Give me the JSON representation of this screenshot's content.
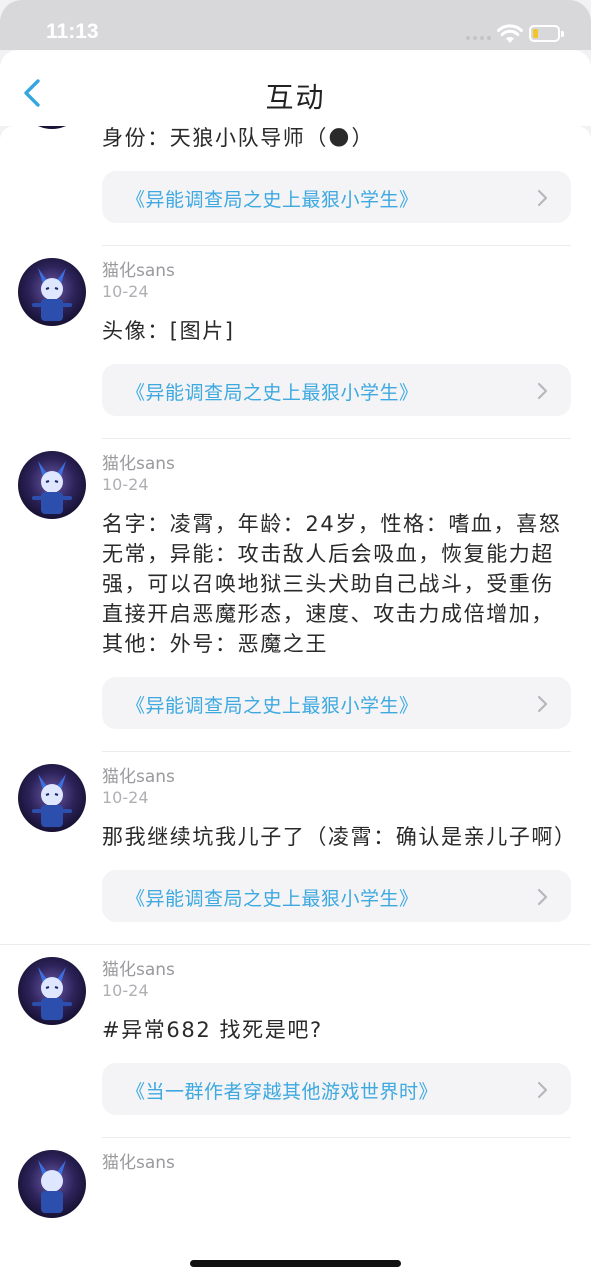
{
  "status_bar": {
    "time": "11:13"
  },
  "header": {
    "title": "互动"
  },
  "posts": [
    {
      "author": "",
      "date": "",
      "text": "身份：天狼小队导师（🌑）",
      "source": "《异能调查局之史上最狠小学生》"
    },
    {
      "author": "猫化sans",
      "date": "10-24",
      "text": "头像：[图片]",
      "source": "《异能调查局之史上最狠小学生》"
    },
    {
      "author": "猫化sans",
      "date": "10-24",
      "text": "名字：凌霄，年龄：24岁，性格：嗜血，喜怒无常，异能：攻击敌人后会吸血，恢复能力超强，可以召唤地狱三头犬助自己战斗，受重伤直接开启恶魔形态，速度、攻击力成倍增加，其他：外号：恶魔之王",
      "source": "《异能调查局之史上最狠小学生》"
    },
    {
      "author": "猫化sans",
      "date": "10-24",
      "text": "那我继续坑我儿子了（凌霄：确认是亲儿子啊）",
      "source": "《异能调查局之史上最狠小学生》"
    },
    {
      "author": "猫化sans",
      "date": "10-24",
      "text": "#异常682 找死是吧?",
      "source": "《当一群作者穿越其他游戏世界时》"
    },
    {
      "author": "猫化sans",
      "date": "",
      "text": "",
      "source": ""
    }
  ],
  "colors": {
    "accent": "#3ea9e0",
    "back_icon": "#35a6df",
    "battery": "#f4c52b"
  }
}
